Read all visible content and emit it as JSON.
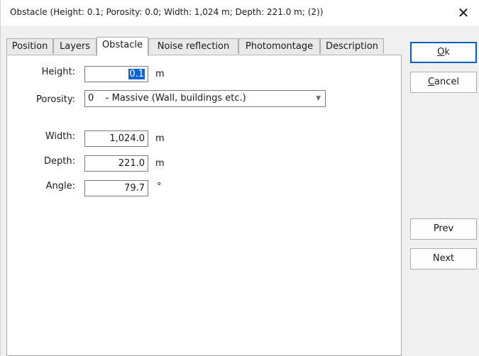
{
  "window": {
    "title": "Obstacle  (Height: 0.1; Porosity: 0.0; Width: 1,024 m; Depth: 221.0 m; (2))",
    "close_glyph": "✕"
  },
  "tabs": [
    {
      "label": "Position"
    },
    {
      "label": "Layers"
    },
    {
      "label": "Obstacle",
      "active": true
    },
    {
      "label": "Noise reflection"
    },
    {
      "label": "Photomontage"
    },
    {
      "label": "Description"
    }
  ],
  "form": {
    "height": {
      "label": "Height:",
      "value": "0.1",
      "unit": "m"
    },
    "porosity": {
      "label": "Porosity:",
      "value": "0    - Massive (Wall, buildings etc.)"
    },
    "width": {
      "label": "Width:",
      "value": "1,024.0",
      "unit": "m"
    },
    "depth": {
      "label": "Depth:",
      "value": "221.0",
      "unit": "m"
    },
    "angle": {
      "label": "Angle:",
      "value": "79.7",
      "unit": "°"
    }
  },
  "buttons": {
    "ok": {
      "mnemonic": "O",
      "rest": "k"
    },
    "cancel": {
      "mnemonic": "C",
      "rest": "ancel"
    },
    "prev": "Prev",
    "next": "Next"
  },
  "colors": {
    "selection": "#0a64d8",
    "default_button_border": "#0060c0"
  }
}
